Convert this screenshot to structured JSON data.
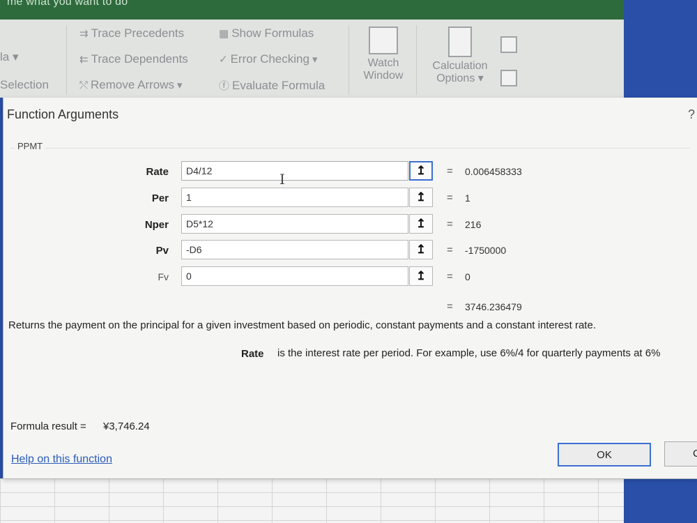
{
  "titlebar": {
    "tell_me": "me what you want to do"
  },
  "ribbon": {
    "left_partial_1": "la ▾",
    "left_partial_2": "Selection",
    "trace_precedents": "Trace Precedents",
    "trace_dependents": "Trace Dependents",
    "remove_arrows": "Remove Arrows",
    "show_formulas": "Show Formulas",
    "error_checking": "Error Checking",
    "evaluate_formula": "Evaluate Formula",
    "watch_window_1": "Watch",
    "watch_window_2": "Window",
    "calc_options_1": "Calculation",
    "calc_options_2": "Options ▾"
  },
  "dialog": {
    "title": "Function Arguments",
    "help_symbol": "?",
    "function_name": "PPMT",
    "arguments": [
      {
        "label": "Rate",
        "value": "D4/12",
        "result": "0.006458333",
        "required": true
      },
      {
        "label": "Per",
        "value": "1",
        "result": "1",
        "required": true
      },
      {
        "label": "Nper",
        "value": "D5*12",
        "result": "216",
        "required": true
      },
      {
        "label": "Pv",
        "value": "-D6",
        "result": "-1750000",
        "required": true
      },
      {
        "label": "Fv",
        "value": "0",
        "result": "0",
        "required": false
      }
    ],
    "ref_button_glyph": "↥",
    "equals_sign": "=",
    "overall_result": "3746.236479",
    "description": "Returns the payment on the principal for a given investment based on periodic, constant payments and a constant interest rate.",
    "arg_desc_name": "Rate",
    "arg_desc_text": "is the interest rate per period. For example, use 6%/4 for quarterly payments at 6%",
    "formula_result_label": "Formula result =",
    "formula_result_value": "¥3,746.24",
    "help_link": "Help on this function",
    "ok_label": "OK",
    "cancel_label": "Cancel"
  },
  "colors": {
    "accent_blue": "#3b6fd0",
    "link_blue": "#2a5bb8",
    "excel_green": "#2e6b3c",
    "background_blue": "#2a4fa8"
  }
}
